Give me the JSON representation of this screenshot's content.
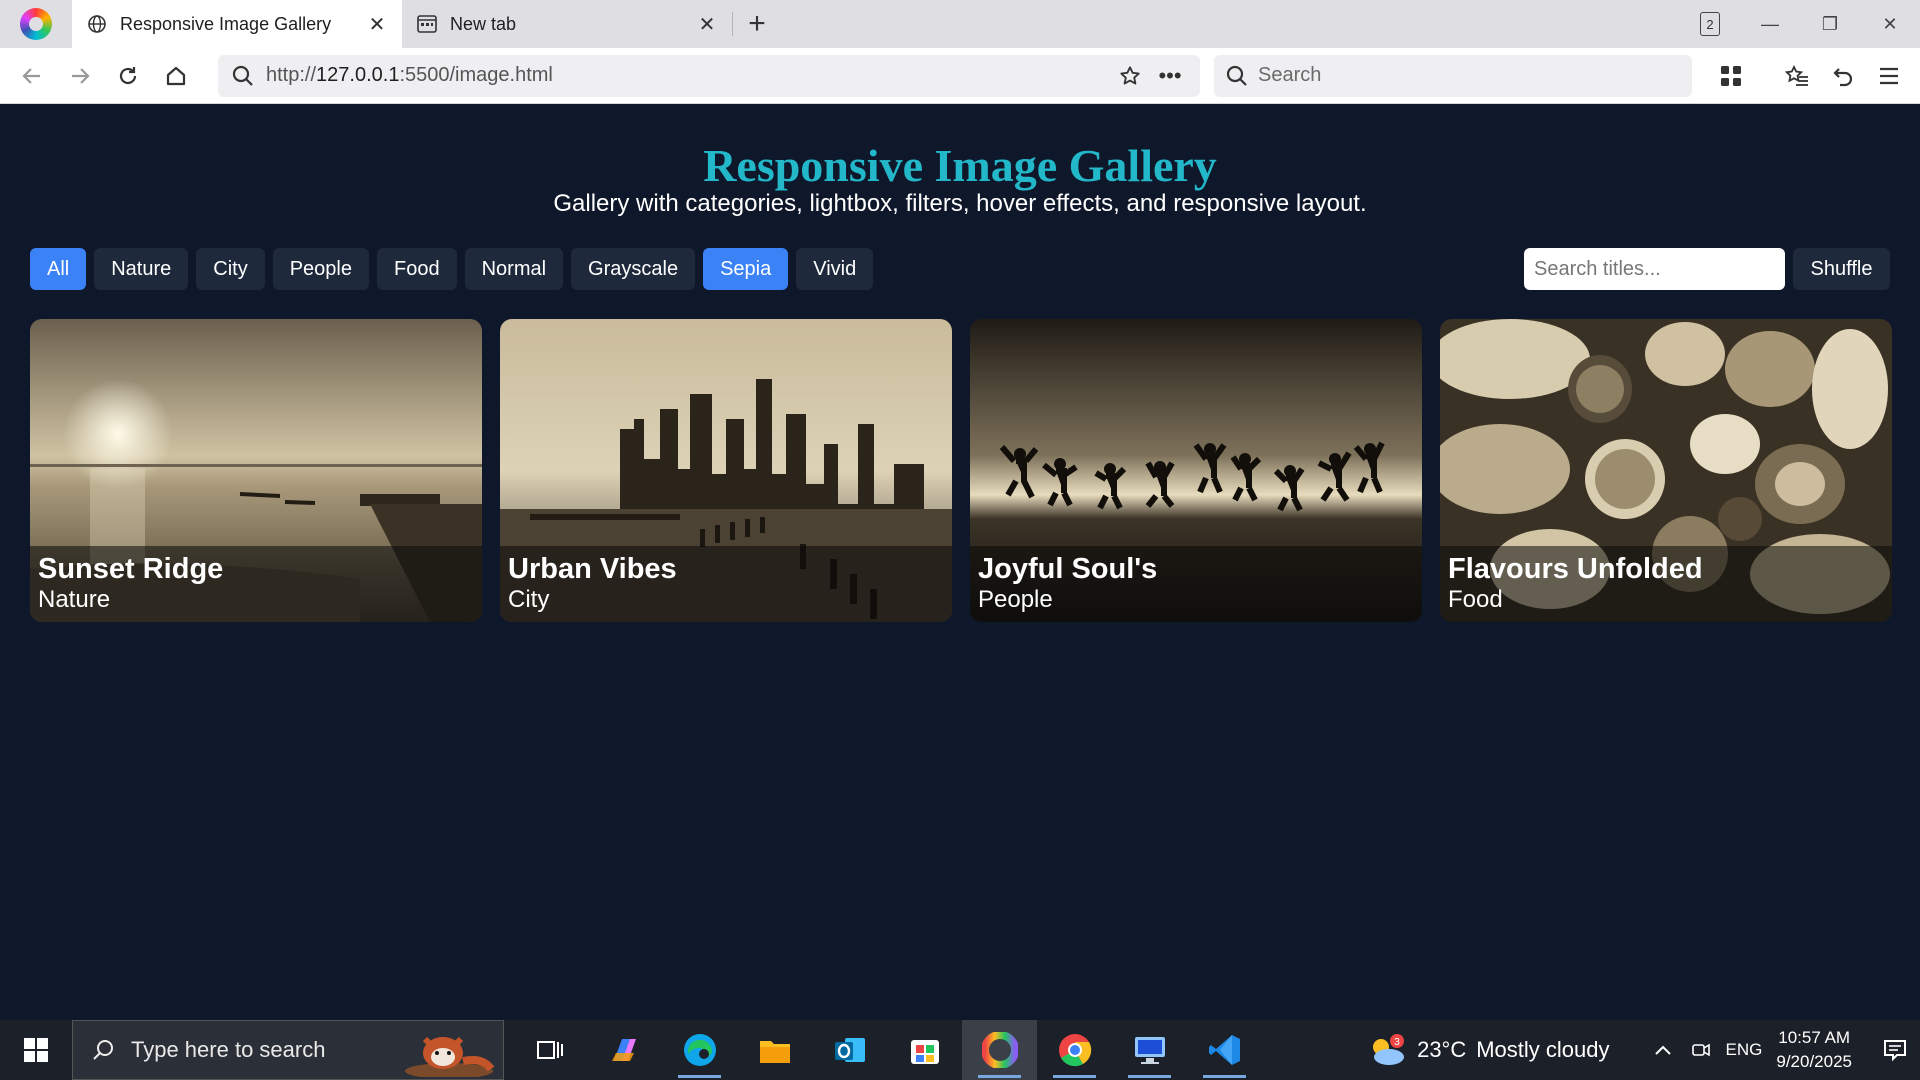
{
  "browser": {
    "tabs": [
      {
        "title": "Responsive Image Gallery",
        "active": true,
        "icon": "globe-icon"
      },
      {
        "title": "New tab",
        "active": false,
        "icon": "newtab-icon"
      }
    ],
    "tab_count": "2",
    "url_scheme": "http://",
    "url_host": "127.0.0.1",
    "url_rest": ":5500/image.html",
    "search_placeholder": "Search"
  },
  "page": {
    "title": "Responsive Image Gallery",
    "subtitle": "Gallery with categories, lightbox, filters, hover effects, and responsive layout.",
    "filters": [
      "All",
      "Nature",
      "City",
      "People",
      "Food",
      "Normal",
      "Grayscale",
      "Sepia",
      "Vivid"
    ],
    "selected_filters": [
      "All",
      "Sepia"
    ],
    "search_placeholder": "Search titles...",
    "shuffle_label": "Shuffle",
    "cards": [
      {
        "title": "Sunset Ridge",
        "category": "Nature"
      },
      {
        "title": "Urban Vibes",
        "category": "City"
      },
      {
        "title": "Joyful Soul's",
        "category": "People"
      },
      {
        "title": "Flavours Unfolded",
        "category": "Food"
      }
    ],
    "colors": {
      "background": "#0f172a",
      "title": "#22b8c9",
      "chip": "#1e293b",
      "chip_selected": "#3b82f6"
    }
  },
  "taskbar": {
    "search_placeholder": "Type here to search",
    "weather_temp": "23°C",
    "weather_desc": "Mostly cloudy",
    "weather_badge": "3",
    "language": "ENG",
    "time": "10:57 AM",
    "date": "9/20/2025"
  }
}
